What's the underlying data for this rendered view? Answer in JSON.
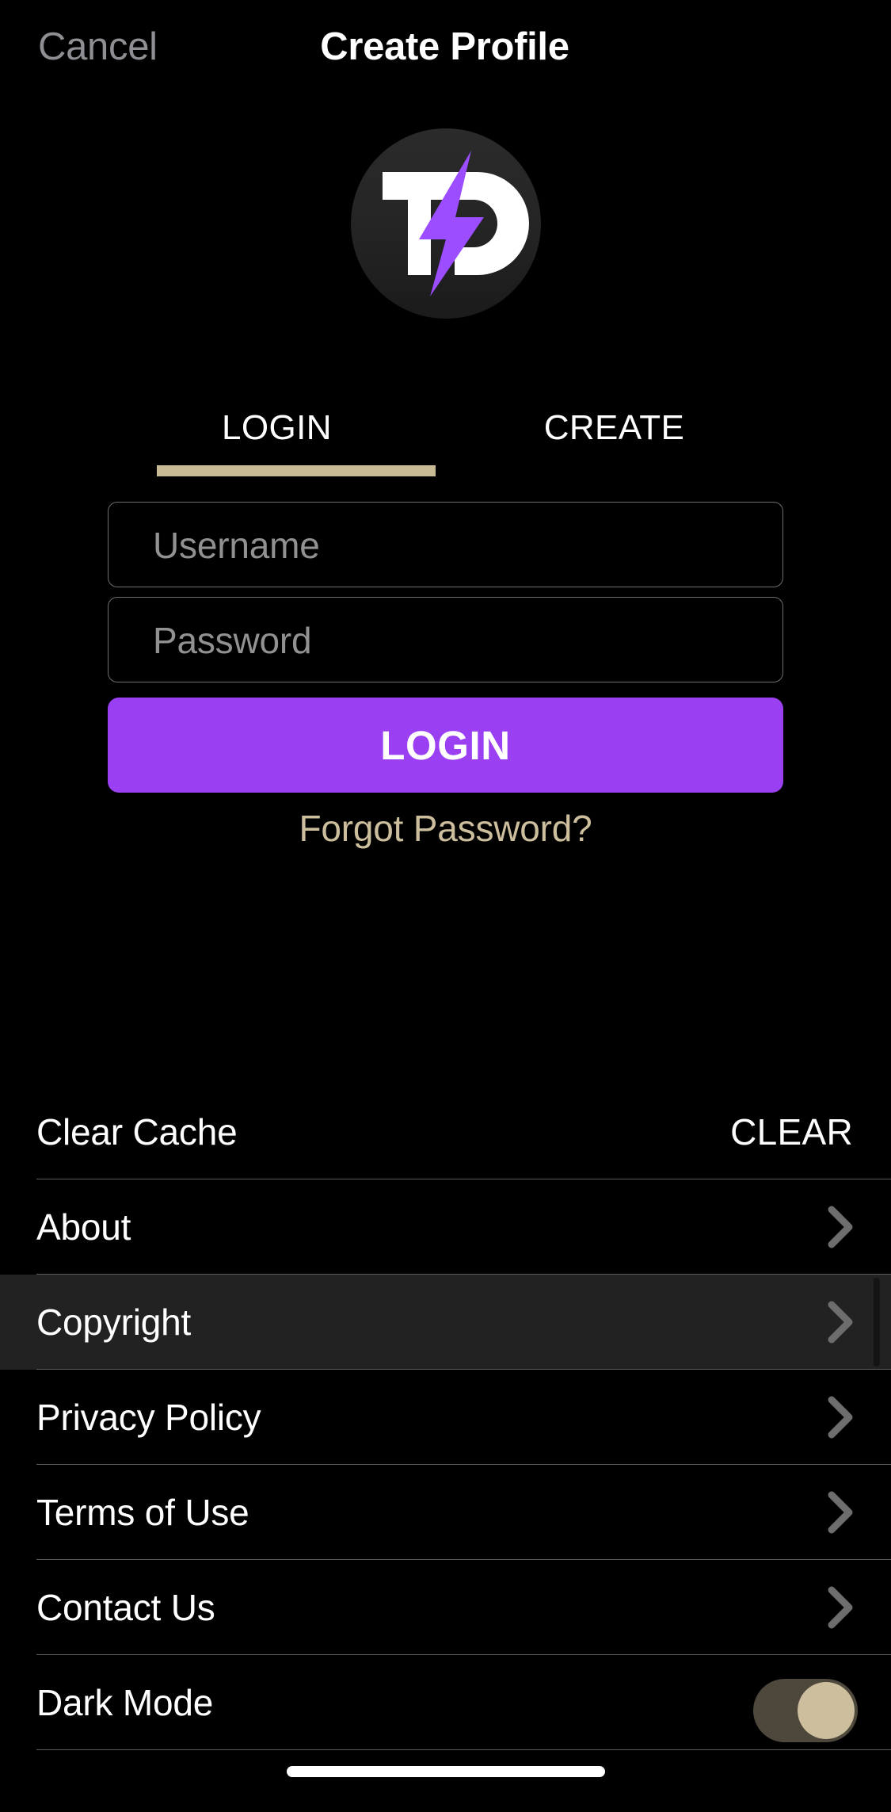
{
  "header": {
    "cancel_label": "Cancel",
    "title": "Create Profile"
  },
  "logo": {
    "name": "td-lightning-logo",
    "letters": "TD",
    "circle_color": "#262626",
    "letter_color": "#ffffff",
    "bolt_color": "#9b4dff"
  },
  "tabs": {
    "items": [
      {
        "label": "LOGIN",
        "selected": true
      },
      {
        "label": "CREATE",
        "selected": false
      }
    ],
    "indicator_color": "#c9ba96"
  },
  "form": {
    "username": {
      "value": "",
      "placeholder": "Username"
    },
    "password": {
      "value": "",
      "placeholder": "Password"
    },
    "submit_label": "LOGIN",
    "submit_color": "#9b3ff2",
    "forgot_label": "Forgot Password?",
    "forgot_color": "#cdbf9e"
  },
  "settings": {
    "rows": [
      {
        "label": "Clear Cache",
        "accessory": "action",
        "action_label": "CLEAR",
        "highlighted": false
      },
      {
        "label": "About",
        "accessory": "chevron",
        "action_label": "",
        "highlighted": false
      },
      {
        "label": "Copyright",
        "accessory": "chevron",
        "action_label": "",
        "highlighted": true
      },
      {
        "label": "Privacy Policy",
        "accessory": "chevron",
        "action_label": "",
        "highlighted": false
      },
      {
        "label": "Terms of Use",
        "accessory": "chevron",
        "action_label": "",
        "highlighted": false
      },
      {
        "label": "Contact Us",
        "accessory": "chevron",
        "action_label": "",
        "highlighted": false
      },
      {
        "label": "Dark Mode",
        "accessory": "toggle",
        "action_label": "",
        "highlighted": false,
        "toggle_on": true
      }
    ],
    "chevron_icon": "chevron-right-icon",
    "toggle_track_color": "#4e483c",
    "toggle_knob_color": "#cdbf9e",
    "divider_color": "#5a5a5a",
    "highlight_color": "#222222"
  },
  "system": {
    "home_indicator": "home-indicator-bar"
  }
}
